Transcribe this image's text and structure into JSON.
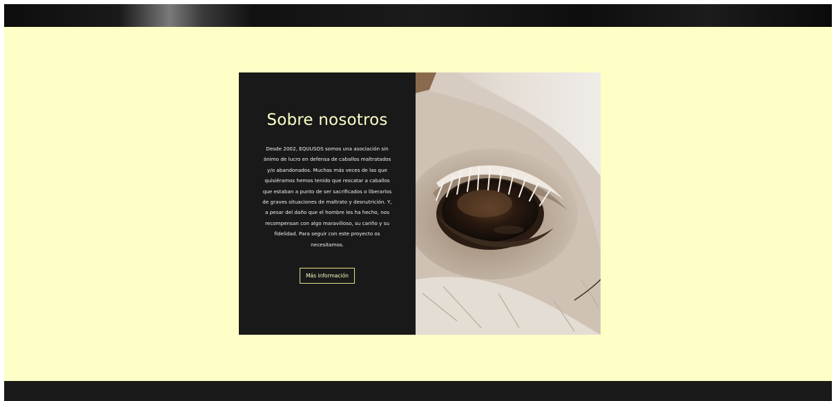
{
  "about": {
    "title": "Sobre nosotros",
    "body": "Desde 2002, EQUUSOS somos una asociación sin ánimo de lucro en defensa de caballos maltratados y/o abandonados. Muchas más veces de las que quisiéramos hemos tenido que rescatar a caballos que estaban a punto de ser sacrificados o liberarlos de graves situaciones de maltrato y desnutrición. Y, a pesar del daño que el hombre les ha hecho, nos recompensan con algo maravilloso, su cariño y su fidelidad. Para seguir con este proyecto os necesitamos.",
    "button_label": "Más información",
    "image_icon": "horse-eye-photo"
  },
  "colors": {
    "band_background": "#feffc6",
    "card_background": "#191919",
    "accent": "#feffc6",
    "footer_background": "#1a1a1a"
  }
}
